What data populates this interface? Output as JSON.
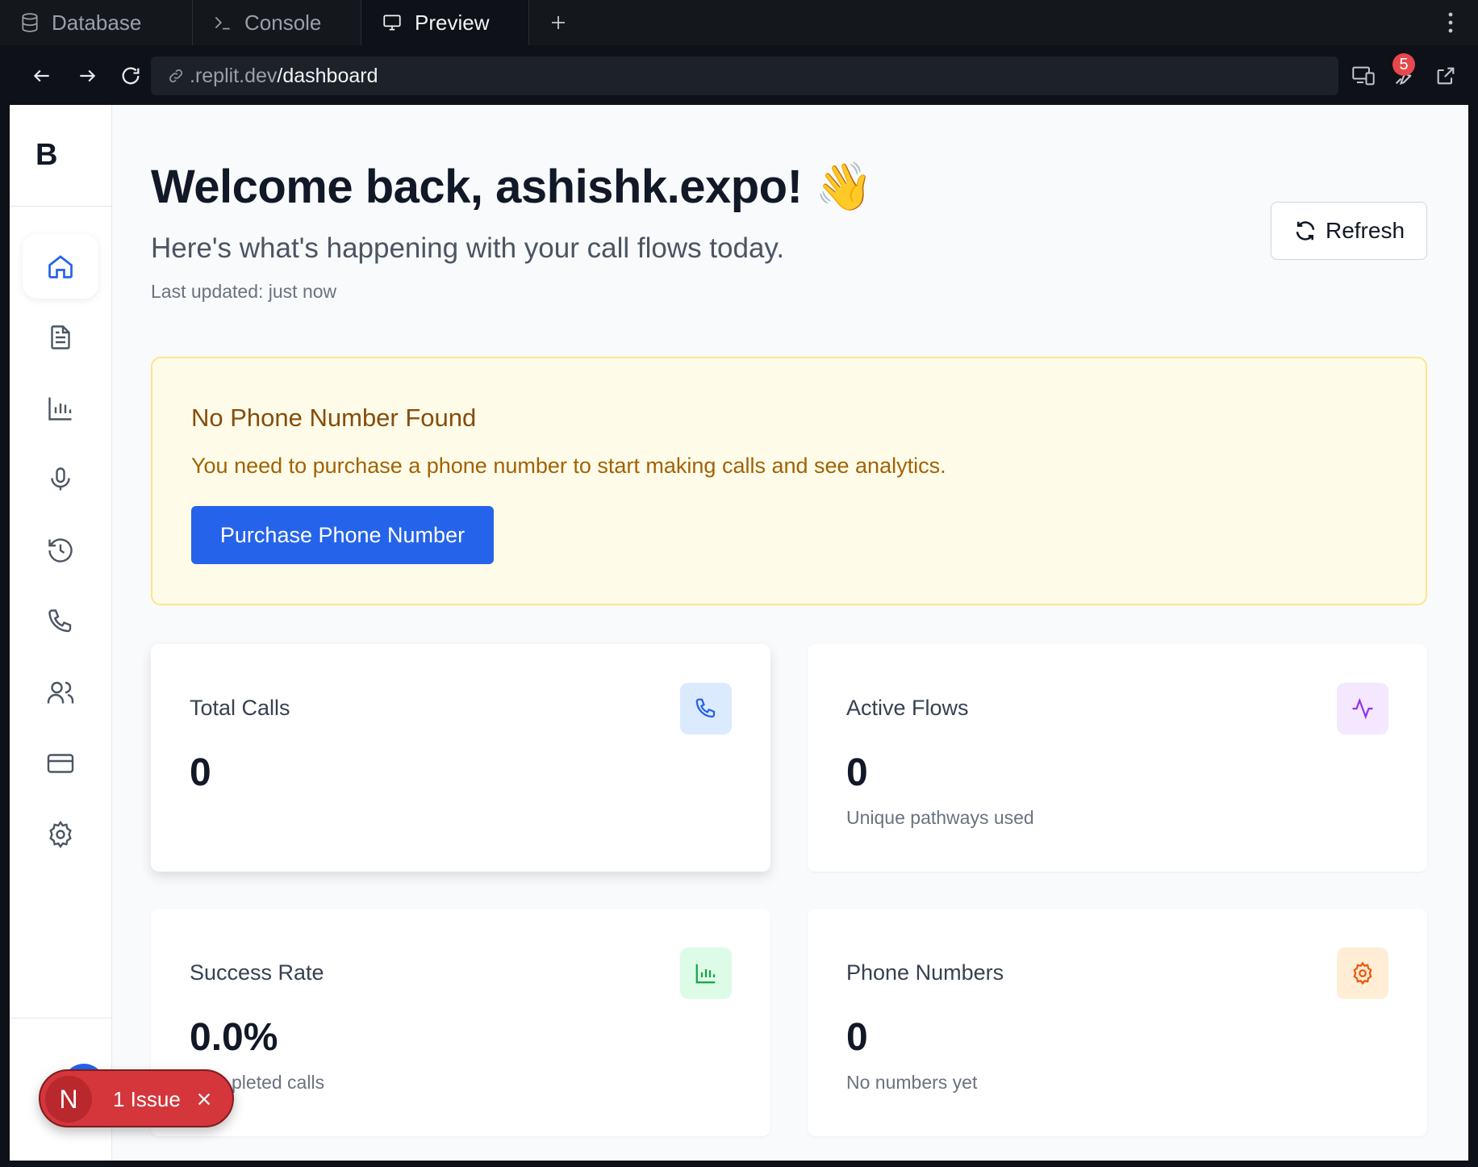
{
  "tabs": [
    {
      "label": "Database",
      "icon": "database-icon"
    },
    {
      "label": "Console",
      "icon": "terminal-icon"
    },
    {
      "label": "Preview",
      "icon": "monitor-icon",
      "active": true
    }
  ],
  "address": {
    "host": ".replit.dev",
    "path": "/dashboard",
    "badge_count": "5"
  },
  "sidebar": {
    "logo": "B",
    "items": [
      {
        "icon": "home-icon",
        "active": true
      },
      {
        "icon": "document-icon"
      },
      {
        "icon": "bar-chart-icon"
      },
      {
        "icon": "microphone-icon"
      },
      {
        "icon": "history-icon"
      },
      {
        "icon": "phone-icon"
      },
      {
        "icon": "users-icon"
      },
      {
        "icon": "credit-card-icon"
      },
      {
        "icon": "settings-icon"
      }
    ]
  },
  "header": {
    "title": "Welcome back, ashishk.expo! 👋",
    "subtitle": "Here's what's happening with your call flows today.",
    "last_updated": "Last updated: just now",
    "refresh_label": "Refresh"
  },
  "alert": {
    "title": "No Phone Number Found",
    "text": "You need to purchase a phone number to start making calls and see analytics.",
    "button": "Purchase Phone Number"
  },
  "stats": [
    {
      "title": "Total Calls",
      "value": "0",
      "sub": "",
      "icon": "phone-icon",
      "color": "#2563eb",
      "bg": "#dbeafe"
    },
    {
      "title": "Active Flows",
      "value": "0",
      "sub": "Unique pathways used",
      "icon": "activity-icon",
      "color": "#9333ea",
      "bg": "#f3e8ff"
    },
    {
      "title": "Success Rate",
      "value": "0.0%",
      "sub": "pleted calls",
      "icon": "bar-chart-icon",
      "color": "#16a34a",
      "bg": "#dcfce7"
    },
    {
      "title": "Phone Numbers",
      "value": "0",
      "sub": "No numbers yet",
      "icon": "settings-icon",
      "color": "#ea580c",
      "bg": "#ffedd5"
    }
  ],
  "issue": {
    "initial": "N",
    "label": "1 Issue"
  }
}
